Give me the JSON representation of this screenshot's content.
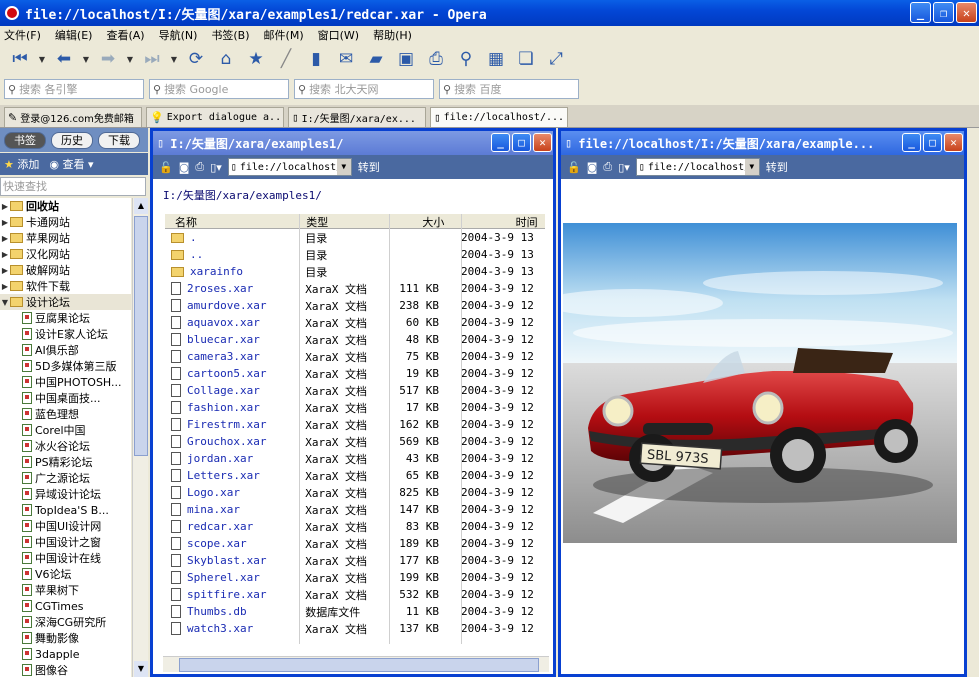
{
  "window": {
    "title": "file://localhost/I:/矢量图/xara/examples1/redcar.xar - Opera"
  },
  "menu": [
    "文件(F)",
    "编辑(E)",
    "查看(A)",
    "导航(N)",
    "书签(B)",
    "邮件(M)",
    "窗口(W)",
    "帮助(H)"
  ],
  "search": [
    {
      "placeholder": "搜索 各引擎"
    },
    {
      "placeholder": "搜索 Google"
    },
    {
      "placeholder": "搜索 北大天网"
    },
    {
      "placeholder": "搜索 百度"
    }
  ],
  "tabs": [
    {
      "label": "登录@126.com免费邮箱"
    },
    {
      "label": "Export dialogue a..."
    },
    {
      "label": "I:/矢量图/xara/ex..."
    },
    {
      "label": "file://localhost/..."
    }
  ],
  "panel": {
    "tabs": [
      "书签",
      "历史",
      "下载"
    ],
    "add": "添加",
    "view": "查看",
    "quick_find": "快速查找",
    "folders": [
      "回收站",
      "卡通网站",
      "苹果网站",
      "汉化网站",
      "破解网站",
      "软件下载",
      "设计论坛"
    ],
    "items": [
      "豆腐果论坛",
      "设计E家人论坛",
      "AI俱乐部",
      "5D多媒体第三版",
      "中国PHOTOSH...",
      "中国桌面技...",
      "蓝色理想",
      "Corel中国",
      "冰火谷论坛",
      "PS精彩论坛",
      "广之源论坛",
      "异域设计论坛",
      "TopIdea'S B...",
      "中国UI设计网",
      "中国设计之窗",
      "中国设计在线",
      "V6论坛",
      "苹果树下",
      "CGTimes",
      "深海CG研究所",
      "舞動影像",
      "3dapple",
      "图像谷"
    ]
  },
  "left_window": {
    "title": "I:/矢量图/xara/examples1/",
    "address": "file://localhost/I",
    "goto": "转到",
    "path": "I:/矢量图/xara/examples1/",
    "headers": [
      "名称",
      "类型",
      "大小",
      "时间"
    ],
    "rows": [
      {
        "name": ".",
        "type": "目录",
        "size": "",
        "time": "2004-3-9 13"
      },
      {
        "name": "..",
        "type": "目录",
        "size": "",
        "time": "2004-3-9 13"
      },
      {
        "name": "xarainfo",
        "type": "目录",
        "size": "",
        "time": "2004-3-9 13"
      },
      {
        "name": "2roses.xar",
        "type": "XaraX 文档",
        "size": "111 KB",
        "time": "2004-3-9 12"
      },
      {
        "name": "amurdove.xar",
        "type": "XaraX 文档",
        "size": "238 KB",
        "time": "2004-3-9 12"
      },
      {
        "name": "aquavox.xar",
        "type": "XaraX 文档",
        "size": "60 KB",
        "time": "2004-3-9 12"
      },
      {
        "name": "bluecar.xar",
        "type": "XaraX 文档",
        "size": "48 KB",
        "time": "2004-3-9 12"
      },
      {
        "name": "camera3.xar",
        "type": "XaraX 文档",
        "size": "75 KB",
        "time": "2004-3-9 12"
      },
      {
        "name": "cartoon5.xar",
        "type": "XaraX 文档",
        "size": "19 KB",
        "time": "2004-3-9 12"
      },
      {
        "name": "Collage.xar",
        "type": "XaraX 文档",
        "size": "517 KB",
        "time": "2004-3-9 12"
      },
      {
        "name": "fashion.xar",
        "type": "XaraX 文档",
        "size": "17 KB",
        "time": "2004-3-9 12"
      },
      {
        "name": "Firestrm.xar",
        "type": "XaraX 文档",
        "size": "162 KB",
        "time": "2004-3-9 12"
      },
      {
        "name": "Grouchox.xar",
        "type": "XaraX 文档",
        "size": "569 KB",
        "time": "2004-3-9 12"
      },
      {
        "name": "jordan.xar",
        "type": "XaraX 文档",
        "size": "43 KB",
        "time": "2004-3-9 12"
      },
      {
        "name": "Letters.xar",
        "type": "XaraX 文档",
        "size": "65 KB",
        "time": "2004-3-9 12"
      },
      {
        "name": "Logo.xar",
        "type": "XaraX 文档",
        "size": "825 KB",
        "time": "2004-3-9 12"
      },
      {
        "name": "mina.xar",
        "type": "XaraX 文档",
        "size": "147 KB",
        "time": "2004-3-9 12"
      },
      {
        "name": "redcar.xar",
        "type": "XaraX 文档",
        "size": "83 KB",
        "time": "2004-3-9 12"
      },
      {
        "name": "scope.xar",
        "type": "XaraX 文档",
        "size": "189 KB",
        "time": "2004-3-9 12"
      },
      {
        "name": "Skyblast.xar",
        "type": "XaraX 文档",
        "size": "177 KB",
        "time": "2004-3-9 12"
      },
      {
        "name": "Spherel.xar",
        "type": "XaraX 文档",
        "size": "199 KB",
        "time": "2004-3-9 12"
      },
      {
        "name": "spitfire.xar",
        "type": "XaraX 文档",
        "size": "532 KB",
        "time": "2004-3-9 12"
      },
      {
        "name": "Thumbs.db",
        "type": "数据库文件",
        "size": "11 KB",
        "time": "2004-3-9 12"
      },
      {
        "name": "watch3.xar",
        "type": "XaraX 文档",
        "size": "137 KB",
        "time": "2004-3-9 12"
      }
    ]
  },
  "right_window": {
    "title": "file://localhost/I:/矢量图/xara/example...",
    "address": "file://localhost/I",
    "goto": "转到",
    "plate": "SBL 973S"
  }
}
